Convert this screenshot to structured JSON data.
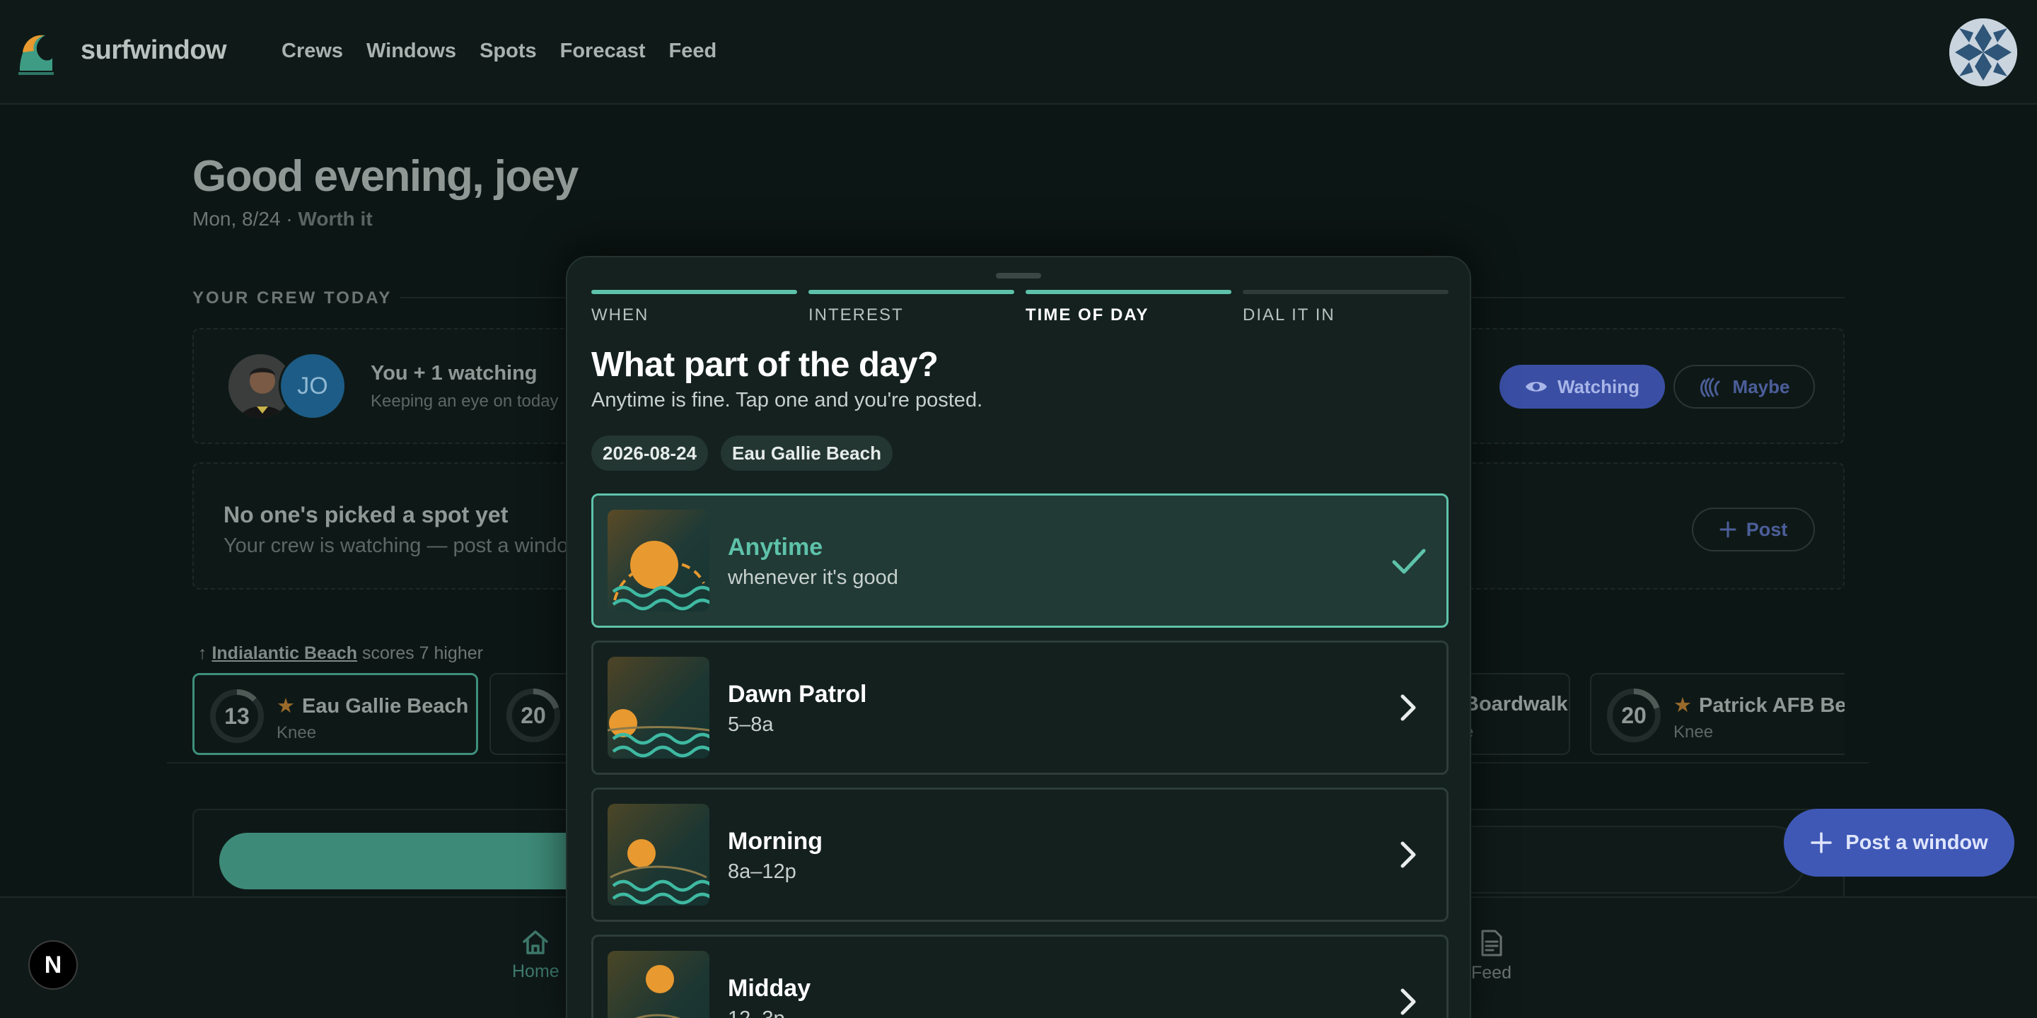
{
  "app": {
    "brand": "surfwindow"
  },
  "nav": {
    "items": [
      "Crews",
      "Windows",
      "Spots",
      "Forecast",
      "Feed"
    ]
  },
  "greeting": {
    "title": "Good evening, joey",
    "date": "Mon, 8/24",
    "separator": "·",
    "status": "Worth it"
  },
  "crew": {
    "section_title": "YOUR CREW TODAY",
    "avatar_initials": "JO",
    "watching_title": "You + 1 watching",
    "watching_sub": "Keeping an eye on today",
    "watching_label": "Watching",
    "maybe_label": "Maybe"
  },
  "nopick": {
    "title": "No one's picked a spot yet",
    "sub": "Your crew is watching — post a windo",
    "post_label": "Post"
  },
  "hint": {
    "arrow": "↑",
    "spot": "Indialantic Beach",
    "text": "scores 7 higher"
  },
  "spots": [
    {
      "score": "13",
      "name": "Eau Gallie Beach",
      "size": "Knee",
      "score_fraction": 0.13
    },
    {
      "score": "20",
      "name": "",
      "size": "",
      "score_fraction": 0.2
    },
    {
      "score": "",
      "name": "Boardwalk",
      "size": "e",
      "score_fraction": 0
    },
    {
      "score": "20",
      "name": "Patrick AFB Bea",
      "size": "Knee",
      "score_fraction": 0.2
    }
  ],
  "row3": {
    "partial_text": "n"
  },
  "fab": {
    "label": "Post a window"
  },
  "bottom_nav": {
    "home": "Home",
    "feed": "Feed",
    "badge": "N"
  },
  "sheet": {
    "steps": [
      {
        "label": "WHEN",
        "state": "done"
      },
      {
        "label": "INTEREST",
        "state": "done"
      },
      {
        "label": "TIME OF DAY",
        "state": "current"
      },
      {
        "label": "DIAL IT IN",
        "state": "todo"
      }
    ],
    "title": "What part of the day?",
    "subtitle": "Anytime is fine. Tap one and you're posted.",
    "chips": [
      "2026-08-24",
      "Eau Gallie Beach"
    ],
    "options": [
      {
        "name": "Anytime",
        "time": "whenever it's good",
        "selected": true
      },
      {
        "name": "Dawn Patrol",
        "time": "5–8a",
        "selected": false
      },
      {
        "name": "Morning",
        "time": "8a–12p",
        "selected": false
      },
      {
        "name": "Midday",
        "time": "12–3p",
        "selected": false
      }
    ]
  },
  "colors": {
    "accent": "#5ec2aa",
    "sun": "#e8992f",
    "primary_button": "#3f58b6",
    "background": "#0c1614"
  }
}
